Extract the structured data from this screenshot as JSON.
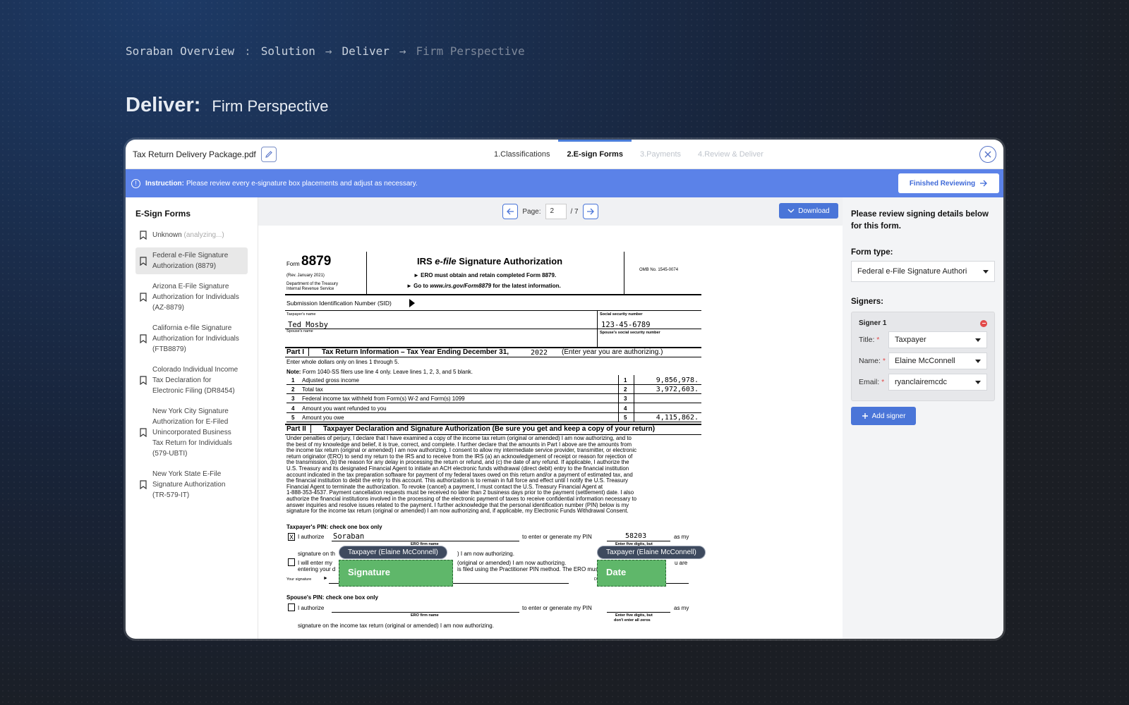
{
  "breadcrumb": {
    "item1": "Soraban Overview",
    "sep1": ":",
    "item2": "Solution",
    "sep2": "→",
    "item3": "Deliver",
    "sep3": "→",
    "item4": "Firm Perspective"
  },
  "page_title": {
    "bold": "Deliver:",
    "rest": "Firm Perspective"
  },
  "topbar": {
    "filename": "Tax Return Delivery Package.pdf",
    "tabs": [
      {
        "label": "1.Classifications"
      },
      {
        "label": "2.E-sign Forms"
      },
      {
        "label": "3.Payments"
      },
      {
        "label": "4.Review & Deliver"
      }
    ]
  },
  "instruction": {
    "label": "Instruction:",
    "text": "Please review every e-signature box placements and adjust as necessary.",
    "button": "Finished Reviewing"
  },
  "sidebar": {
    "title": "E-Sign Forms",
    "items": [
      {
        "line1": "Unknown",
        "muted": "(analyzing...)"
      },
      {
        "line1": "Federal e-File Signature",
        "line2": "Authorization (8879)"
      },
      {
        "line1": "Arizona E-File Signature",
        "line2": "Authorization for Individuals",
        "line3": "(AZ-8879)"
      },
      {
        "line1": "California e-file Signature",
        "line2": "Authorization for Individuals",
        "line3": "(FTB8879)"
      },
      {
        "line1": "Colorado Individual Income",
        "line2": "Tax Declaration for",
        "line3": "Electronic Filing (DR8454)"
      },
      {
        "line1": "New York City Signature",
        "line2": "Authorization for E-Filed",
        "line3": "Unincorporated Business",
        "line4": "Tax Return for Individuals",
        "line5": "(579-UBTI)"
      },
      {
        "line1": "New York State E-File",
        "line2": "Signature Authorization",
        "line3": "(TR-579-IT)"
      }
    ]
  },
  "pager": {
    "label": "Page:",
    "current": "2",
    "total": "/ 7",
    "download": "Download"
  },
  "form": {
    "form_word": "Form",
    "form_number": "8879",
    "rev": "(Rev. January 2021)",
    "dept1": "Department of the Treasury",
    "dept2": "Internal Revenue Service",
    "title_a": "IRS ",
    "title_b": "e-file",
    "title_c": " Signature Authorization",
    "sub1": "► ERO must obtain and retain completed Form 8879.",
    "sub2a": "► Go to ",
    "sub2b": "www.irs.gov/Form8879",
    "sub2c": " for the latest information.",
    "omb": "OMB No. 1545-0074",
    "sid": "Submission Identification Number (SID)",
    "taxpayer_name_label": "Taxpayer's name",
    "taxpayer_name": "Ted Mosby",
    "spouse_name_label": "Spouse's name",
    "ssn_label": "Social security number",
    "ssn": "123-45-6789",
    "spouse_ssn_label": "Spouse's social security number",
    "part1_label": "Part I",
    "part1_title": "Tax Return Information – Tax Year Ending December 31,",
    "tax_year": "2022",
    "part1_note": "(Enter year you are authorizing.)",
    "whole_dollars": "Enter whole dollars only on lines 1 through 5.",
    "note_bold": "Note:",
    "note_text": "Form 1040-SS filers use line 4 only. Leave lines 1, 2, 3, and 5 blank.",
    "lines": [
      {
        "num": "1",
        "label": "Adjusted gross income",
        "value": "9,856,978."
      },
      {
        "num": "2",
        "label": "Total tax",
        "value": "3,972,603."
      },
      {
        "num": "3",
        "label": "Federal income tax withheld from Form(s) W-2 and Form(s) 1099",
        "value": ""
      },
      {
        "num": "4",
        "label": "Amount you want refunded to you",
        "value": ""
      },
      {
        "num": "5",
        "label": "Amount you owe",
        "value": "4,115,862."
      }
    ],
    "part2_label": "Part II",
    "part2_title": "Taxpayer Declaration and Signature Authorization (Be sure you get and keep a copy of your return)",
    "decl": [
      "Under penalties of perjury, I declare that I have examined a copy of the income tax return (original or amended) I am now authorizing, and to",
      "the best of my knowledge and belief, it is true, correct, and complete. I further declare that the amounts in Part I above are the amounts from",
      "the income tax return (original or amended) I am now authorizing. I consent to allow my intermediate service provider, transmitter, or electronic",
      "return originator (ERO) to send my return to the IRS and to receive from the IRS (a) an acknowledgement of receipt or reason for rejection of",
      "the transmission, (b) the reason for any delay in processing the return or refund, and (c) the date of any refund. If applicable, I authorize the",
      "U.S. Treasury and its designated Financial Agent to initiate an ACH electronic funds withdrawal (direct debit) entry to the financial institution",
      "account indicated in the tax preparation software for payment of my federal taxes owed on this return and/or a payment of estimated tax, and",
      "the financial institution to debit the entry to this account. This authorization is to remain in full force and effect until I notify the U.S. Treasury",
      "Financial Agent to terminate the authorization. To revoke (cancel) a payment, I must contact the U.S. Treasury Financial Agent at",
      "1-888-353-4537. Payment cancellation requests must be received no later than 2 business days prior to the payment (settlement) date. I also",
      "authorize the financial institutions involved in the processing of the electronic payment of taxes to receive confidential information necessary to",
      "answer inquiries and resolve issues related to the payment. I further acknowledge that the personal identification number (PIN) below is my",
      "signature for the income tax return (original or amended) I am now authorizing and, if applicable, my Electronic Funds Withdrawal Consent."
    ],
    "tp_pin_heading": "Taxpayer's PIN: check one box only",
    "check_x": "X",
    "i_authorize": "I authorize",
    "ero_name": "Soraban",
    "ero_firm_name": "ERO firm name",
    "to_enter": "to enter or generate my PIN",
    "pin": "58203",
    "as_my": "as my",
    "enter_five": "Enter five digits, but",
    "sig_line_a": "signature on th",
    "sig_line_b": ") I am now authorizing.",
    "will_enter_a": "I will enter my",
    "will_enter_b": "(original or amended) I am now authorizing.",
    "will_enter_c": "u are",
    "entering_a": "entering your d",
    "entering_b": "is filed using the Practitioner PIN method. The ERO must complete",
    "your_signature": "Your signature",
    "date_frag": "Date",
    "sp_pin_heading": "Spouse's PIN: check one box only",
    "sp_i_authorize": "I authorize",
    "sp_ero_firm_name": "ERO firm name",
    "sp_to_enter": "to enter or generate my PIN",
    "sp_as_my": "as my",
    "sp_enter_five": "Enter five digits, but",
    "sp_dont_enter": "don't enter all zeros",
    "sp_sig_line": "signature on the income tax return (original or amended) I am now authorizing."
  },
  "overlays": {
    "tag1": "Taxpayer (Elaine McConnell)",
    "tag2": "Taxpayer (Elaine McConnell)",
    "sig_box": "Signature",
    "date_box": "Date"
  },
  "rightpanel": {
    "heading_line1": "Please review signing details below",
    "heading_line2": "for this form.",
    "form_type_label": "Form type:",
    "form_type_value": "Federal e-File Signature Authori",
    "signers_label": "Signers:",
    "signer_title": "Signer 1",
    "title_label": "Title:",
    "title_value": "Taxpayer",
    "name_label": "Name:",
    "name_value": "Elaine McConnell",
    "email_label": "Email:",
    "email_value": "ryanclairemcdc",
    "add_signer": "Add signer",
    "required_mark": "*"
  },
  "colors": {
    "accent": "#4a75d8",
    "instruction_bg": "#5b82e8",
    "sig_green": "#5fb76a",
    "tag_bg": "#3e4a5e"
  }
}
